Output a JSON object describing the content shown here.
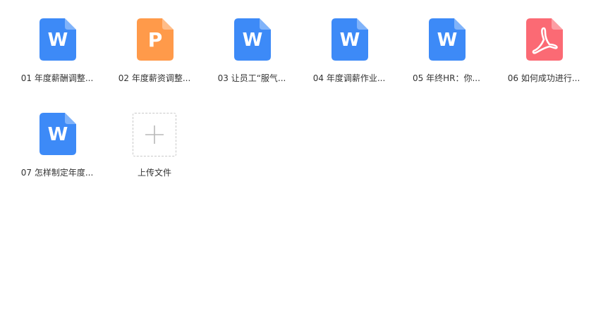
{
  "files": [
    {
      "name": "01 年度薪酬调整...",
      "type": "word",
      "icon": "word-doc-icon",
      "letter": "W",
      "color": "#3d8af7"
    },
    {
      "name": "02 年度薪资调整...",
      "type": "ppt",
      "icon": "ppt-doc-icon",
      "letter": "P",
      "color": "#ff9a4a"
    },
    {
      "name": "03 让员工“服气...",
      "type": "word",
      "icon": "word-doc-icon",
      "letter": "W",
      "color": "#3d8af7"
    },
    {
      "name": "04 年度调薪作业...",
      "type": "word",
      "icon": "word-doc-icon",
      "letter": "W",
      "color": "#3d8af7"
    },
    {
      "name": "05 年终HR：你...",
      "type": "word",
      "icon": "word-doc-icon",
      "letter": "W",
      "color": "#3d8af7"
    },
    {
      "name": "06 如何成功进行...",
      "type": "pdf",
      "icon": "pdf-doc-icon",
      "letter": "",
      "color": "#fb6a74"
    },
    {
      "name": "07 怎样制定年度...",
      "type": "word",
      "icon": "word-doc-icon",
      "letter": "W",
      "color": "#3d8af7"
    }
  ],
  "upload": {
    "label": "上传文件",
    "icon": "plus-icon"
  }
}
